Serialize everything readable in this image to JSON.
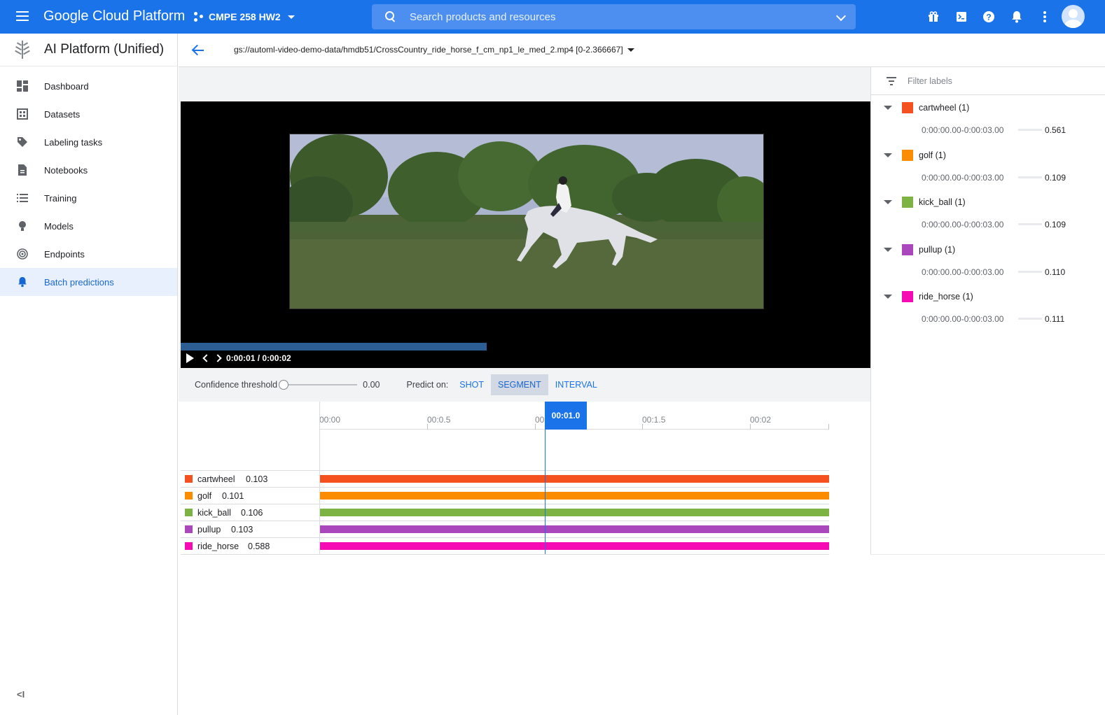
{
  "topbar": {
    "brand": "Google Cloud Platform",
    "project": "CMPE 258 HW2",
    "search_placeholder": "Search products and resources",
    "color": "#1a73e8"
  },
  "sidebar": {
    "title": "AI Platform (Unified)",
    "items": [
      {
        "label": "Dashboard",
        "icon": "dashboard-icon",
        "active": false
      },
      {
        "label": "Datasets",
        "icon": "datasets-icon",
        "active": false
      },
      {
        "label": "Labeling tasks",
        "icon": "tag-icon",
        "active": false
      },
      {
        "label": "Notebooks",
        "icon": "notebook-icon",
        "active": false
      },
      {
        "label": "Training",
        "icon": "list-icon",
        "active": false
      },
      {
        "label": "Models",
        "icon": "lightbulb-icon",
        "active": false
      },
      {
        "label": "Endpoints",
        "icon": "target-icon",
        "active": false
      },
      {
        "label": "Batch predictions",
        "icon": "bell-icon",
        "active": true
      }
    ],
    "collapse_label": "<I"
  },
  "subheader": {
    "file_path": "gs://automl-video-demo-data/hmdb51/CrossCountry_ride_horse_f_cm_np1_le_med_2.mp4 [0-2.366667]"
  },
  "video": {
    "time_display": "0:00:01 / 0:00:02",
    "progress": 0.444
  },
  "controls": {
    "confidence_label": "Confidence threshold",
    "confidence_value": "0.00",
    "predict_label": "Predict on:",
    "tabs": [
      {
        "label": "SHOT",
        "active": false
      },
      {
        "label": "SEGMENT",
        "active": true
      },
      {
        "label": "INTERVAL",
        "active": false
      }
    ]
  },
  "timeline": {
    "ticks": [
      "00:00",
      "00:0.5",
      "00",
      "00:1.5",
      "00:02"
    ],
    "current": "00:01.0",
    "rows": [
      {
        "name": "cartwheel",
        "score": "0.103",
        "color": "#f4511e"
      },
      {
        "name": "golf",
        "score": "0.101",
        "color": "#fb8c00"
      },
      {
        "name": "kick_ball",
        "score": "0.106",
        "color": "#7cb342"
      },
      {
        "name": "pullup",
        "score": "0.103",
        "color": "#ab47bc"
      },
      {
        "name": "ride_horse",
        "score": "0.588",
        "color": "#f50ab4"
      }
    ]
  },
  "labels_panel": {
    "filter_placeholder": "Filter labels",
    "groups": [
      {
        "name": "cartwheel (1)",
        "color": "#f4511e",
        "segment": "0:00:00.00-0:00:03.00",
        "score": "0.561",
        "value": 0.561
      },
      {
        "name": "golf (1)",
        "color": "#fb8c00",
        "segment": "0:00:00.00-0:00:03.00",
        "score": "0.109",
        "value": 0.109
      },
      {
        "name": "kick_ball (1)",
        "color": "#7cb342",
        "segment": "0:00:00.00-0:00:03.00",
        "score": "0.109",
        "value": 0.109
      },
      {
        "name": "pullup (1)",
        "color": "#ab47bc",
        "segment": "0:00:00.00-0:00:03.00",
        "score": "0.110",
        "value": 0.11
      },
      {
        "name": "ride_horse (1)",
        "color": "#f50ab4",
        "segment": "0:00:00.00-0:00:03.00",
        "score": "0.111",
        "value": 0.111
      }
    ]
  }
}
